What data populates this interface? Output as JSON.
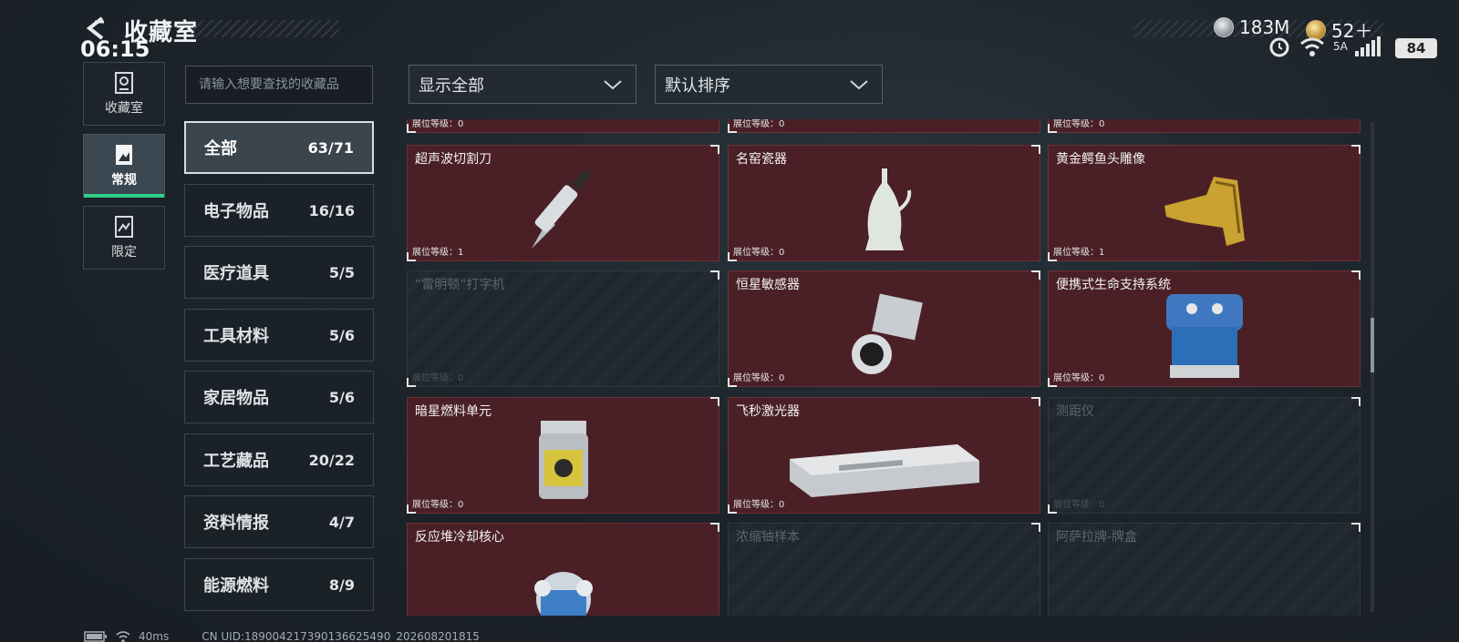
{
  "header": {
    "title": "收藏室",
    "clock": "06:15"
  },
  "currency": {
    "silver": "183M",
    "gold": "52＋"
  },
  "status": {
    "battery": "84",
    "net_label": "5A"
  },
  "rail": [
    {
      "label": "收藏室",
      "icon": "collection-room-icon"
    },
    {
      "label": "常规",
      "icon": "normal-collection-icon",
      "active": true
    },
    {
      "label": "限定",
      "icon": "limited-collection-icon"
    }
  ],
  "search": {
    "placeholder": "请输入想要查找的收藏品"
  },
  "categories": [
    {
      "name": "全部",
      "count": "63/71",
      "active": true
    },
    {
      "name": "电子物品",
      "count": "16/16"
    },
    {
      "name": "医疗道具",
      "count": "5/5"
    },
    {
      "name": "工具材料",
      "count": "5/6"
    },
    {
      "name": "家居物品",
      "count": "5/6"
    },
    {
      "name": "工艺藏品",
      "count": "20/22"
    },
    {
      "name": "资料情报",
      "count": "4/7"
    },
    {
      "name": "能源燃料",
      "count": "8/9"
    }
  ],
  "filters": {
    "show": "显示全部",
    "sort": "默认排序"
  },
  "items": [
    {
      "name": "",
      "level": "展位等级：0",
      "owned": true
    },
    {
      "name": "",
      "level": "展位等级：0",
      "owned": true
    },
    {
      "name": "",
      "level": "展位等级：0",
      "owned": true
    },
    {
      "name": "超声波切割刀",
      "level": "展位等级：1",
      "owned": true
    },
    {
      "name": "名窑瓷器",
      "level": "展位等级：0",
      "owned": true
    },
    {
      "name": "黄金鳄鱼头雕像",
      "level": "展位等级：1",
      "owned": true
    },
    {
      "name": "“雷明顿”打字机",
      "level": "展位等级：0",
      "owned": false
    },
    {
      "name": "恒星敏感器",
      "level": "展位等级：0",
      "owned": true
    },
    {
      "name": "便携式生命支持系统",
      "level": "展位等级：0",
      "owned": true
    },
    {
      "name": "暗星燃料单元",
      "level": "展位等级：0",
      "owned": true
    },
    {
      "name": "飞秒激光器",
      "level": "展位等级：0",
      "owned": true
    },
    {
      "name": "测距仪",
      "level": "展位等级：0",
      "owned": false
    },
    {
      "name": "反应堆冷却核心",
      "level": "",
      "owned": true
    },
    {
      "name": "浓缩铀样本",
      "level": "",
      "owned": false
    },
    {
      "name": "阿萨拉牌-牌盒",
      "level": "",
      "owned": false
    }
  ],
  "footer": {
    "ping": "40ms",
    "uid": "CN UID:189004217390136625490_202608201815"
  }
}
